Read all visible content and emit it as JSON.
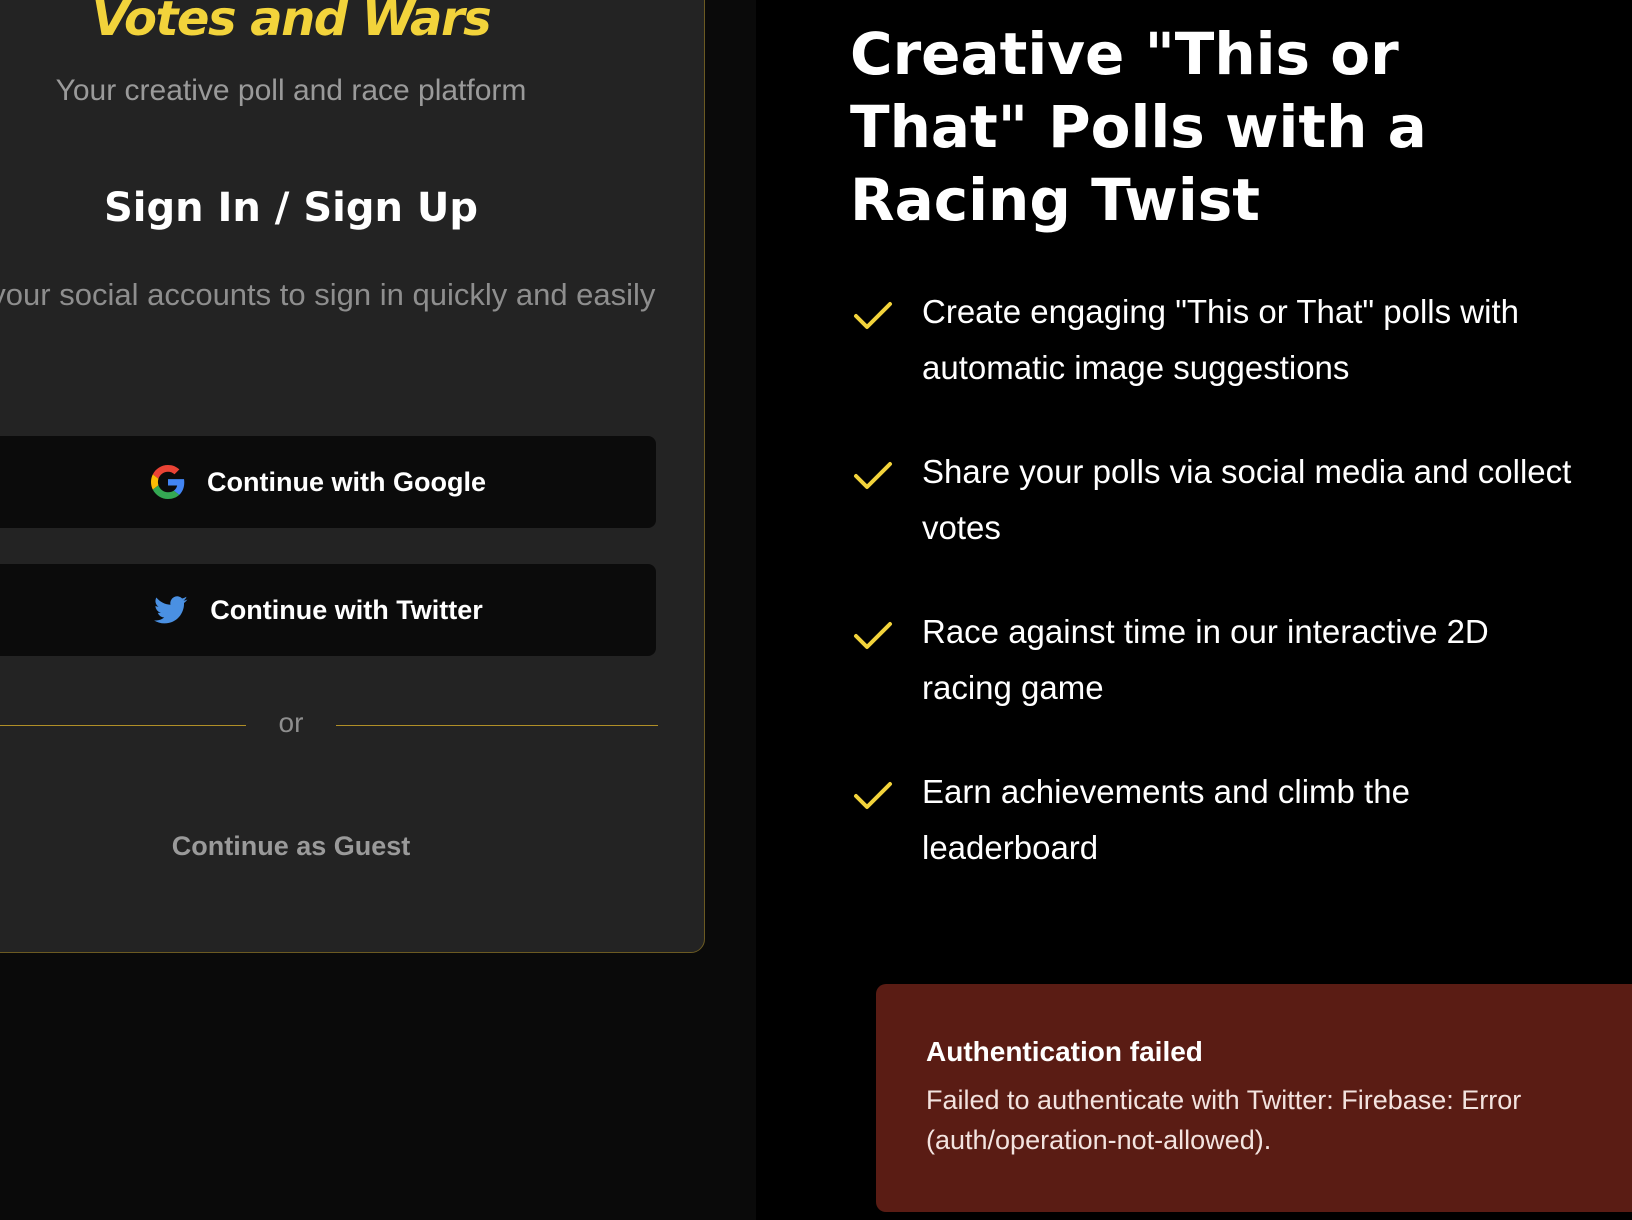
{
  "auth": {
    "brand": "Votes and Wars",
    "tagline": "Your creative poll and race platform",
    "heading": "Sign In / Sign Up",
    "subtext": "Use your social accounts to sign in quickly and easily",
    "google_button_label": "Continue with Google",
    "twitter_button_label": "Continue with Twitter",
    "divider_text": "or",
    "guest_link": "Continue as Guest"
  },
  "hero": {
    "title": "Creative \"This or That\" Polls with a Racing Twist",
    "features": [
      "Create engaging \"This or That\" polls with automatic image suggestions",
      "Share your polls via social media and collect votes",
      "Race against time in our interactive 2D racing game",
      "Earn achievements and climb the leaderboard"
    ]
  },
  "toast": {
    "title": "Authentication failed",
    "message": "Failed to authenticate with Twitter: Firebase: Error (auth/operation-not-allowed)."
  },
  "colors": {
    "brand_yellow": "#f2d33b",
    "card_background": "#232323",
    "card_border": "#6b5a22",
    "button_background": "#0b0b0b",
    "divider": "#b08f27",
    "toast_background": "#5a1c14",
    "twitter_blue": "#4a90e2"
  },
  "icons": {
    "google": "google-icon",
    "twitter": "twitter-icon",
    "check": "check-icon"
  }
}
